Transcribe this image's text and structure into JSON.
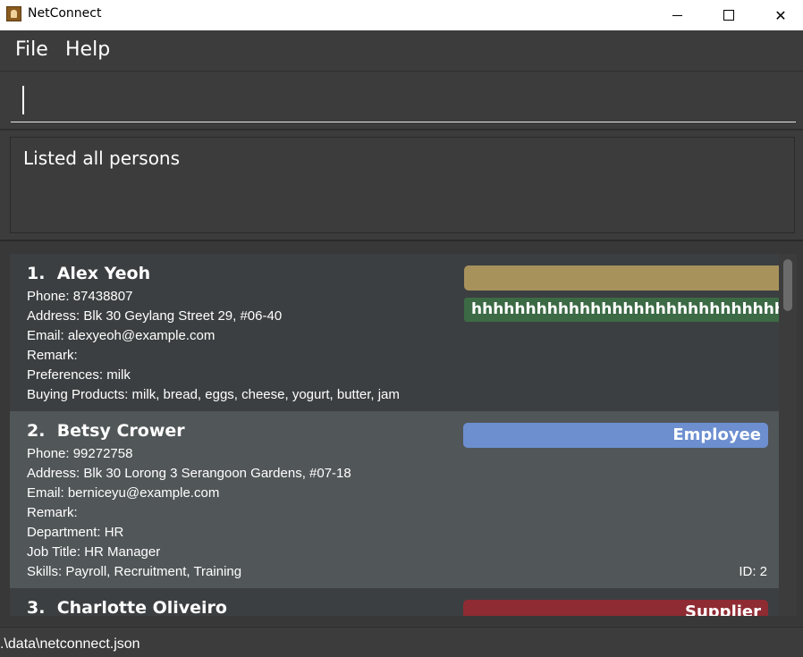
{
  "window": {
    "title": "NetConnect",
    "minimize_icon": "minimize-icon",
    "maximize_icon": "maximize-icon",
    "close_label": "✕"
  },
  "menu": {
    "file": "File",
    "help": "Help"
  },
  "command": {
    "value": ""
  },
  "result": {
    "message": "Listed all persons"
  },
  "persons": [
    {
      "index": "1.",
      "name": "Alex Yeoh",
      "lines": [
        "Phone: 87438807",
        "Address: Blk 30 Geylang Street 29, #06-40",
        "Email: alexyeoh@example.com",
        "Remark:",
        "Preferences: milk",
        "Buying Products: milk, bread, eggs, cheese, yogurt, butter, jam"
      ],
      "tags": [
        {
          "label": "",
          "color": "#a8925c"
        },
        {
          "label": "hhhhhhhhhhhhhhhhhhhhhhhhhhhhhhhhhhhhh",
          "color": "#3c6a45"
        }
      ]
    },
    {
      "index": "2.",
      "name": "Betsy Crower",
      "lines": [
        "Phone: 99272758",
        "Address: Blk 30 Lorong 3 Serangoon Gardens, #07-18",
        "Email: berniceyu@example.com",
        "Remark:",
        "Department: HR",
        "Job Title: HR Manager",
        "Skills: Payroll, Recruitment, Training"
      ],
      "tags": [
        {
          "label": "Employee",
          "color": "#6d8fd0"
        }
      ],
      "id": "ID: 2"
    },
    {
      "index": "3.",
      "name": "Charlotte Oliveiro",
      "lines": [],
      "tags": [
        {
          "label": "Supplier",
          "color": "#8f2b33"
        }
      ]
    }
  ],
  "status": {
    "path": ".\\data\\netconnect.json"
  }
}
